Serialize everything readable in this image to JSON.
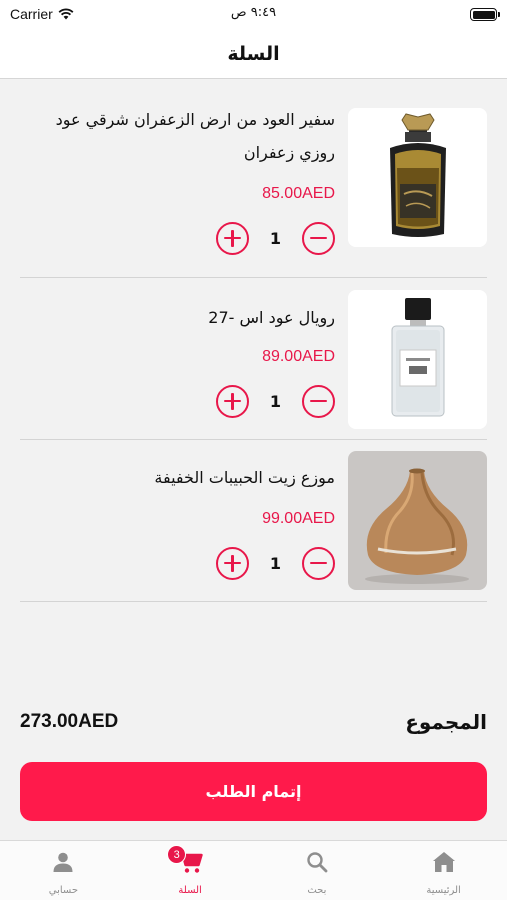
{
  "status_bar": {
    "carrier": "Carrier",
    "time": "٩:٤٩ ص"
  },
  "header": {
    "title": "السلة"
  },
  "cart": {
    "items": [
      {
        "name": "سفير العود من ارض الزعفران شرقي عود روزي زعفران",
        "price": "85.00AED",
        "quantity": "1",
        "image_icon": "perfume-bottle-gold-icon"
      },
      {
        "name": "رويال عود اس -27",
        "price": "89.00AED",
        "quantity": "1",
        "image_icon": "perfume-bottle-clear-icon"
      },
      {
        "name": "موزع  زيت الحبيبات الخفيفة",
        "price": "99.00AED",
        "quantity": "1",
        "image_icon": "diffuser-icon"
      }
    ]
  },
  "summary": {
    "total_label": "المجموع",
    "total_value": "273.00AED"
  },
  "checkout": {
    "label": "إتمام الطلب"
  },
  "tab_bar": {
    "tabs": [
      {
        "label": "حسابي",
        "icon": "person-icon"
      },
      {
        "label": "السلة",
        "icon": "cart-icon",
        "badge": "3"
      },
      {
        "label": "بحث",
        "icon": "search-icon"
      },
      {
        "label": "الرئيسية",
        "icon": "home-icon"
      }
    ]
  },
  "colors": {
    "accent": "#e8174a",
    "button": "#ff1a4b",
    "background": "#f2f2f2"
  }
}
